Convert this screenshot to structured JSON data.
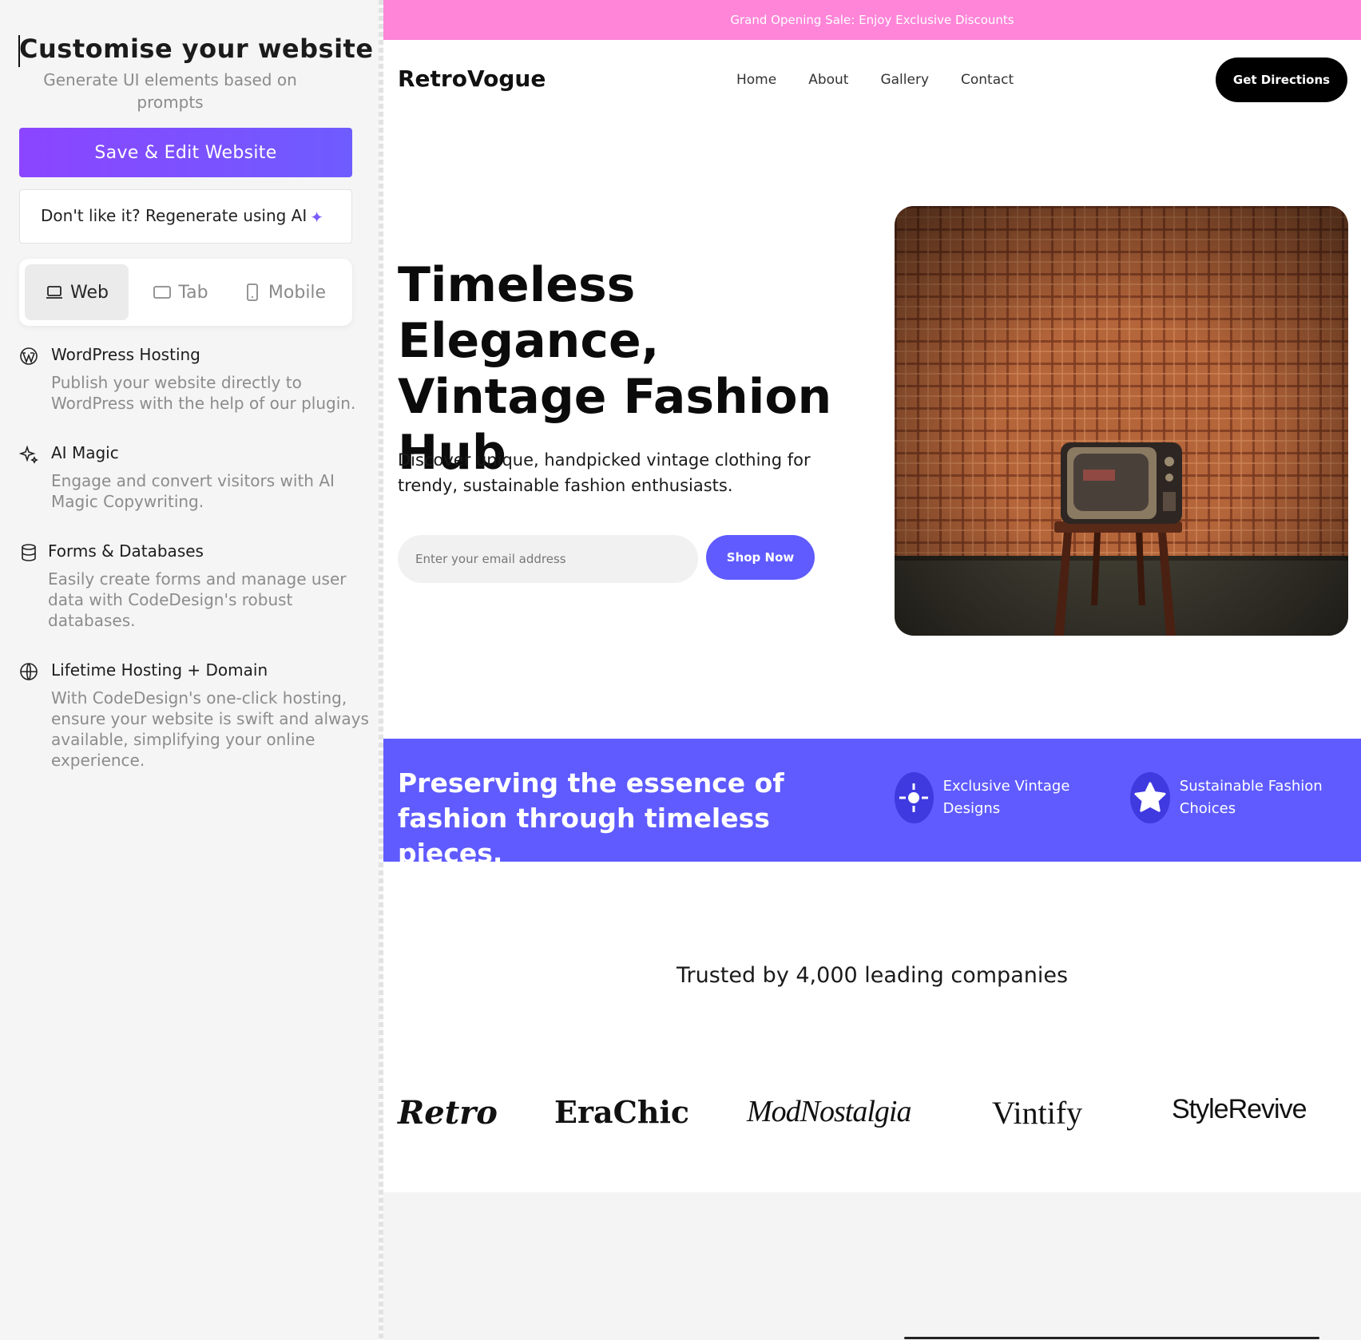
{
  "sidebar": {
    "title": "Customise your website",
    "subtitle": "Generate UI elements based on prompts",
    "save_button": "Save & Edit Website",
    "regen_button": "Don't like it? Regenerate using AI",
    "device_tabs": [
      "Web",
      "Tab",
      "Mobile"
    ],
    "active_tab": "Web",
    "features": [
      {
        "title": "WordPress Hosting",
        "desc": "Publish your website directly to WordPress with the help of our plugin.",
        "icon": "wordpress-icon"
      },
      {
        "title": "AI Magic",
        "desc": "Engage and convert visitors with AI Magic Copywriting.",
        "icon": "sparkle-icon"
      },
      {
        "title": "Forms & Databases",
        "desc": "Easily create forms and manage user data with CodeDesign's robust databases.",
        "icon": "database-icon"
      },
      {
        "title": "Lifetime Hosting + Domain",
        "desc": "With CodeDesign's one-click hosting, ensure your website is swift and always available, simplifying your online experience.",
        "icon": "globe-icon"
      }
    ]
  },
  "site": {
    "announcement": "Grand Opening Sale: Enjoy Exclusive Discounts",
    "logo": "RetroVogue",
    "nav": [
      "Home",
      "About",
      "Gallery",
      "Contact"
    ],
    "cta": "Get Directions",
    "hero_title": "Timeless Elegance, Vintage Fashion Hub",
    "hero_sub": "Discover unique, handpicked vintage clothing for trendy, sustainable fashion enthusiasts.",
    "email_placeholder": "Enter your email address",
    "shop_button": "Shop Now",
    "band_text": "Preserving the essence of fashion through timeless pieces.",
    "band_features": [
      "Exclusive Vintage Designs",
      "Sustainable Fashion Choices"
    ],
    "trusted": "Trusted by 4,000 leading companies",
    "brands": [
      "Retro",
      "EraChic",
      "ModNostalgia",
      "Vintify",
      "StyleRevive"
    ]
  },
  "colors": {
    "accent": "#5f5bff",
    "announcement_bg": "#ff85d8",
    "save_gradient": [
      "#8b45ff",
      "#6e5cff"
    ]
  }
}
